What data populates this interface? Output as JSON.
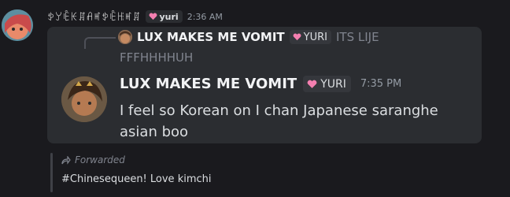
{
  "author": {
    "name": "ꉣꌦꍟꀘꁲꋬꎭꉣꍟꆿꎭꁲ",
    "tag": "yuri",
    "timestamp": "2:36 AM"
  },
  "reply": {
    "name": "LUX MAKES ME VOMIT",
    "tag": "YURI",
    "text_line1": "ITS LIJE",
    "text_line2": "FFFHHHHUH"
  },
  "quoted": {
    "name": "LUX MAKES ME VOMIT",
    "tag": "YURI",
    "timestamp": "7:35 PM",
    "text": "I feel so Korean on I chan Japanese saranghe asian boo"
  },
  "forwarded": {
    "label": "Forwarded",
    "text": "#Chinesequeen! Love kimchi"
  },
  "colors": {
    "background": "#1a1a1e",
    "embed": "#2b2d31",
    "heart": "#f47fb0"
  }
}
